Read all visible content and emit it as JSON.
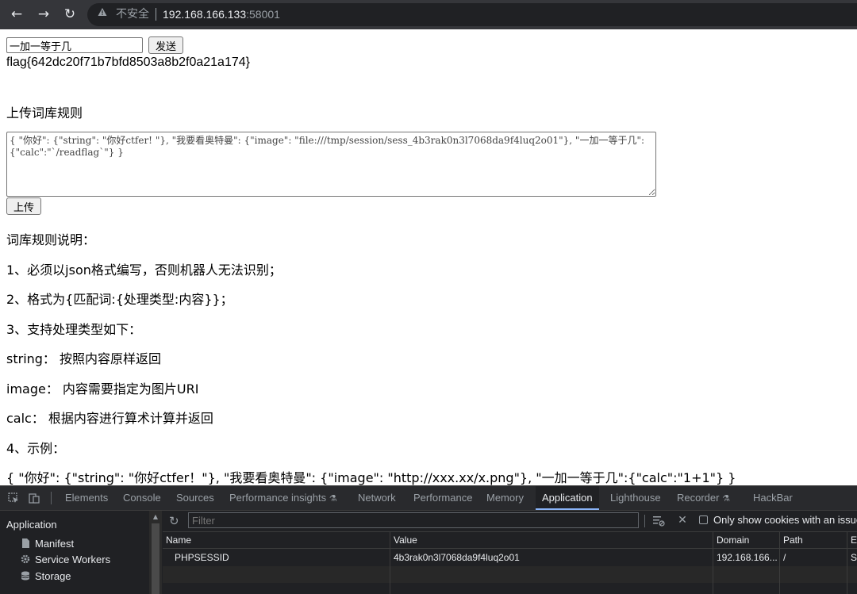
{
  "browser": {
    "insecure_label": "不安全",
    "url_host": "192.168.166.133",
    "url_port": ":58001"
  },
  "page": {
    "question_value": "一加一等于几",
    "send_label": "发送",
    "flag_text": "flag{642dc20f71b7bfd8503a8b2f0a21a174}",
    "upload_heading": "上传词库规则",
    "rules_textarea": "{ \"你好\": {\"string\": \"你好ctfer! \"}, \"我要看奥特曼\": {\"image\": \"file:///tmp/session/sess_4b3rak0n3l7068da9f4luq2o01\"}, \"一加一等于几\":{\"calc\":\"`/readflag`\"} }",
    "upload_label": "上传",
    "instructions": [
      "词库规则说明：",
      "1、必须以json格式编写，否则机器人无法识别；",
      "2、格式为{匹配词:{处理类型:内容}}；",
      "3、支持处理类型如下：",
      "string： 按照内容原样返回",
      "image： 内容需要指定为图片URI",
      "calc： 根据内容进行算术计算并返回",
      "4、示例：",
      "{ \"你好\": {\"string\": \"你好ctfer！\"}, \"我要看奥特曼\": {\"image\": \"http://xxx.xx/x.png\"}, \"一加一等于几\":{\"calc\":\"1+1\"} }"
    ]
  },
  "devtools": {
    "tabs": [
      "Elements",
      "Console",
      "Sources",
      "Performance insights",
      "Network",
      "Performance",
      "Memory",
      "Application",
      "Lighthouse",
      "Recorder",
      "HackBar"
    ],
    "active_tab": "Application",
    "sidebar": {
      "title": "Application",
      "items": [
        "Manifest",
        "Service Workers",
        "Storage"
      ]
    },
    "filter_placeholder": "Filter",
    "only_issue_label": "Only show cookies with an issue",
    "columns": [
      "Name",
      "Value",
      "Domain",
      "Path",
      "Ex"
    ],
    "cookie": {
      "name": "PHPSESSID",
      "value": "4b3rak0n3l7068da9f4luq2o01",
      "domain": "192.168.166...",
      "path": "/",
      "expires": "Se"
    }
  },
  "colors": {
    "accent": "#8ab4f8",
    "devtools_bg": "#202124",
    "toolbar_bg": "#35363a"
  }
}
